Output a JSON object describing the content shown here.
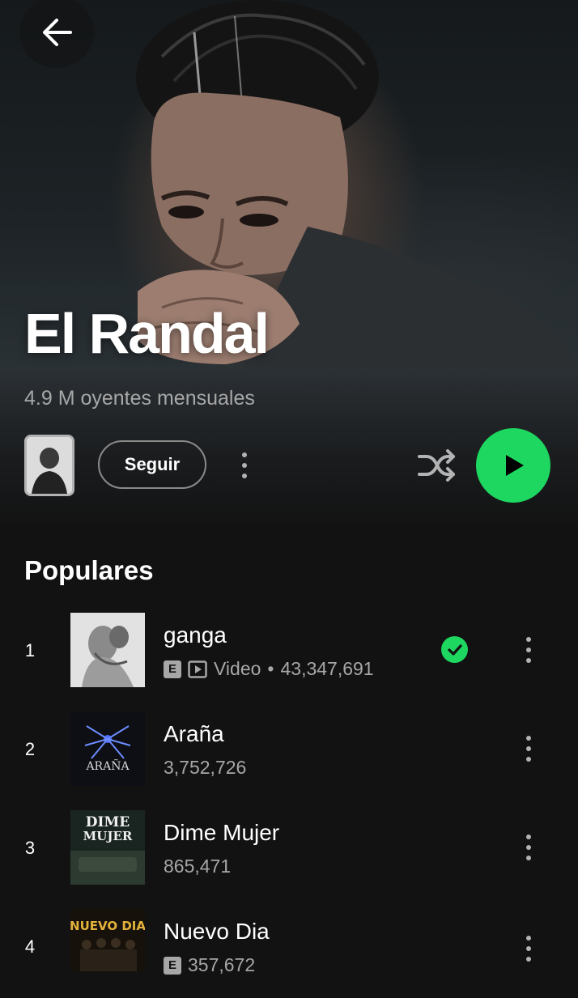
{
  "artist": {
    "name": "El Randal",
    "monthly_listeners": "4.9 M oyentes mensuales"
  },
  "actions": {
    "follow_label": "Seguir"
  },
  "section": {
    "title": "Populares"
  },
  "tracks": [
    {
      "number": "1",
      "title": "ganga",
      "explicit": "E",
      "video_label": "Video",
      "separator": "•",
      "plays": "43,347,691",
      "saved": true
    },
    {
      "number": "2",
      "title": "Araña",
      "plays": "3,752,726"
    },
    {
      "number": "3",
      "title": "Dime Mujer",
      "plays": "865,471"
    },
    {
      "number": "4",
      "title": "Nuevo Dia",
      "explicit": "E",
      "plays": "357,672"
    }
  ],
  "artwork_text": {
    "arana": "ARAÑA",
    "dime_mujer_line1": "DIME",
    "dime_mujer_line2": "MUJER",
    "nuevo_dia": "NUEVO DIA"
  },
  "colors": {
    "background": "#121212",
    "accent_green": "#1ed760",
    "secondary_text": "#a7a7a7"
  },
  "icons": [
    "back-arrow-icon",
    "more-vert-icon",
    "shuffle-icon",
    "play-icon",
    "check-icon",
    "explicit-icon",
    "video-icon"
  ]
}
